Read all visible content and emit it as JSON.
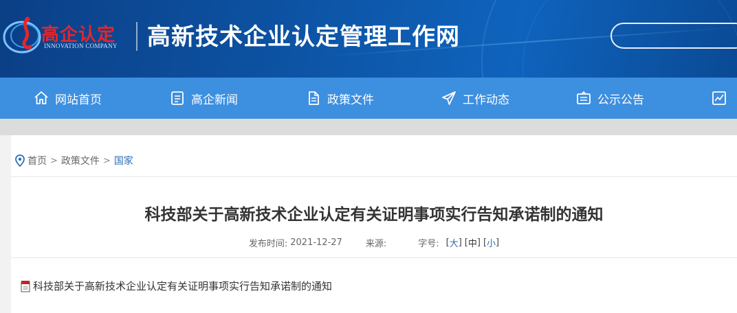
{
  "header": {
    "logo_cn": "高企认定",
    "logo_en": "INNOVATION COMPANY",
    "site_title": "高新技术企业认定管理工作网"
  },
  "nav": {
    "items": [
      {
        "label": "网站首页",
        "icon": "home-icon"
      },
      {
        "label": "高企新闻",
        "icon": "document-list-icon"
      },
      {
        "label": "政策文件",
        "icon": "file-icon"
      },
      {
        "label": "工作动态",
        "icon": "paper-plane-icon"
      },
      {
        "label": "公示公告",
        "icon": "notice-board-icon"
      },
      {
        "label": "",
        "icon": "chart-icon"
      }
    ]
  },
  "breadcrumb": {
    "icon": "location-pin-icon",
    "items": [
      "首页",
      "政策文件",
      "国家"
    ],
    "separator": ">"
  },
  "article": {
    "title": "科技部关于高新技术企业认定有关证明事项实行告知承诺制的通知",
    "publish_label": "发布时间:",
    "publish_date": "2021-12-27",
    "source_label": "来源:",
    "font_size_label": "字号:",
    "font_sizes": [
      "大",
      "中",
      "小"
    ],
    "attachment_text": "科技部关于高新技术企业认定有关证明事项实行告知承诺制的通知",
    "attachment_icon": "pdf-file-icon"
  },
  "colors": {
    "banner": "#0d56a8",
    "nav": "#3d8fe0",
    "logo_red": "#e3262c",
    "link_blue": "#2b6fb6"
  }
}
